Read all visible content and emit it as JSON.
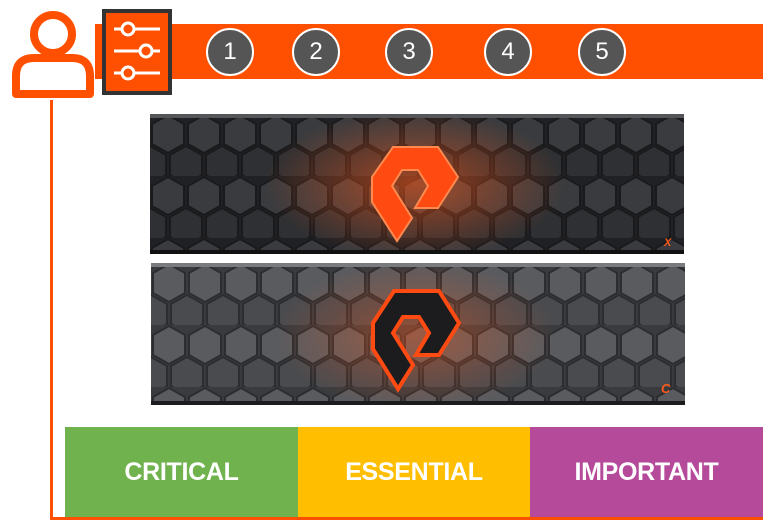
{
  "colors": {
    "accent": "#fe5000",
    "critical": "#70b34e",
    "essential": "#ffbf00",
    "important": "#b5499a",
    "step_badge": "#555555"
  },
  "header": {
    "icons": [
      "user-icon",
      "settings-sliders-icon"
    ],
    "steps": [
      "1",
      "2",
      "3",
      "4",
      "5"
    ]
  },
  "devices": [
    {
      "icon": "flasharray-x-device",
      "badge": "X"
    },
    {
      "icon": "flasharray-c-device",
      "badge": "C"
    }
  ],
  "tiers": [
    {
      "label": "CRITICAL"
    },
    {
      "label": "ESSENTIAL"
    },
    {
      "label": "IMPORTANT"
    }
  ]
}
